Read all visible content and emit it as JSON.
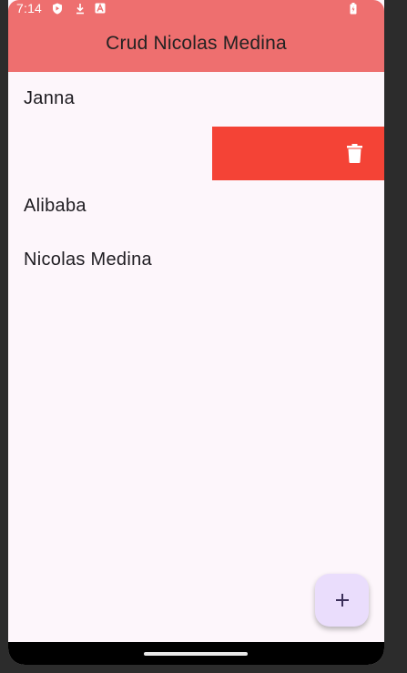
{
  "status_bar": {
    "time": "7:14",
    "icons": [
      "shield-icon",
      "download-icon",
      "a-badge-icon",
      "battery-charging-icon"
    ]
  },
  "app_bar": {
    "title": "Crud Nicolas Medina",
    "color": "#ee6f6f"
  },
  "list": {
    "items": [
      {
        "label": "Janna"
      },
      {
        "label": "",
        "swiped": true,
        "action_icon": "trash-icon",
        "action_color": "#f44336"
      },
      {
        "label": "Alibaba"
      },
      {
        "label": "Nicolas Medina"
      }
    ]
  },
  "fab": {
    "icon": "plus-icon",
    "color": "#eaddfc"
  }
}
